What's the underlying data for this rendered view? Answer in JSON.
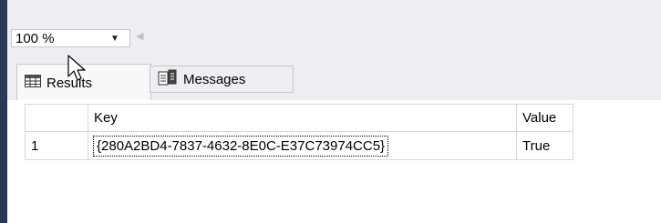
{
  "zoom": {
    "value": "100 %"
  },
  "tabs": [
    {
      "label": "Results",
      "icon": "grid-icon"
    },
    {
      "label": "Messages",
      "icon": "messages-icon"
    }
  ],
  "grid": {
    "columns": [
      "Key",
      "Value"
    ],
    "rows": [
      {
        "row_number": "1",
        "key": "{280A2BD4-7837-4632-8E0C-E37C73974CC5}",
        "value": "True"
      }
    ]
  },
  "colors": {
    "sidebar": "#293955",
    "toolbar": "#eeeef2",
    "grid_border": "#d6d6d6"
  }
}
